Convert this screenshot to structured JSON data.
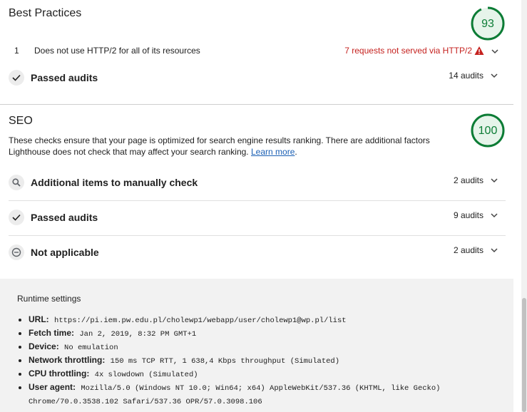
{
  "best_practices": {
    "title": "Best Practices",
    "score": "93",
    "score_fraction": 0.93,
    "score_color": "#0c7c35",
    "audits": [
      {
        "index": "1",
        "title": "Does not use HTTP/2 for all of its resources",
        "display_value": "7 requests not served via HTTP/2",
        "icon": "warning-triangle-icon"
      }
    ],
    "groups": [
      {
        "title": "Passed audits",
        "count": "14 audits",
        "icon": "checkmark-icon"
      }
    ]
  },
  "seo": {
    "title": "SEO",
    "score": "100",
    "score_fraction": 1.0,
    "score_color": "#0c7c35",
    "description": "These checks ensure that your page is optimized for search engine results ranking. There are additional factors Lighthouse does not check that may affect your search ranking.",
    "learn_more": "Learn more",
    "description_end": ".",
    "groups": [
      {
        "title": "Additional items to manually check",
        "count": "2 audits",
        "icon": "search-icon"
      },
      {
        "title": "Passed audits",
        "count": "9 audits",
        "icon": "checkmark-icon"
      },
      {
        "title": "Not applicable",
        "count": "2 audits",
        "icon": "minus-circle-icon"
      }
    ]
  },
  "runtime_settings": {
    "title": "Runtime settings",
    "items": [
      {
        "label": "URL:",
        "value": "https://pi.iem.pw.edu.pl/cholewp1/webapp/user/cholewp1@wp.pl/list"
      },
      {
        "label": "Fetch time:",
        "value": "Jan 2, 2019, 8:32 PM GMT+1"
      },
      {
        "label": "Device:",
        "value": "No emulation"
      },
      {
        "label": "Network throttling:",
        "value": "150 ms TCP RTT, 1 638,4 Kbps throughput (Simulated)"
      },
      {
        "label": "CPU throttling:",
        "value": "4x slowdown (Simulated)"
      },
      {
        "label": "User agent:",
        "value": "Mozilla/5.0 (Windows NT 10.0; Win64; x64) AppleWebKit/537.36 (KHTML, like Gecko) Chrome/70.0.3538.102 Safari/537.36 OPR/57.0.3098.106"
      }
    ]
  },
  "colors": {
    "pass": "#0c7c35",
    "fail_text": "#c5221f",
    "warning": "#c5221f",
    "link": "#1a5fb4",
    "runtime_bg": "#f2f2f2"
  }
}
